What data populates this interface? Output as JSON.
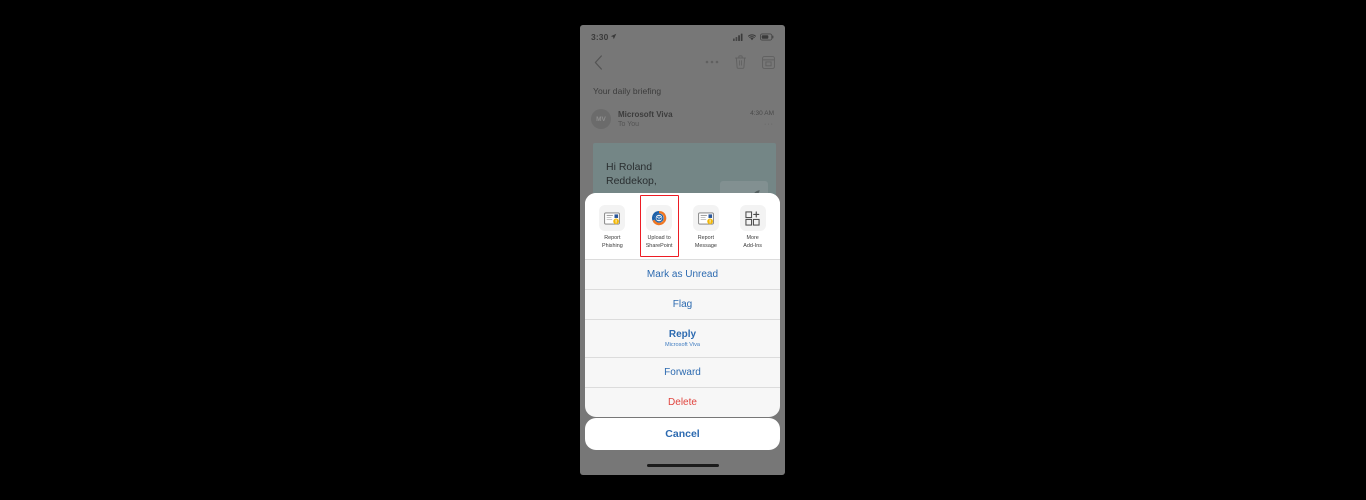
{
  "status_bar": {
    "time": "3:30",
    "location_icon": "location-arrow-icon",
    "signal_icon": "cellular-signal-icon",
    "wifi_icon": "wifi-icon",
    "battery_icon": "battery-icon"
  },
  "nav_bar": {
    "back_icon": "chevron-left-icon",
    "more_icon": "ellipsis-icon",
    "delete_icon": "trash-icon",
    "archive_icon": "archive-icon"
  },
  "email": {
    "subject": "Your daily briefing",
    "avatar_initials": "MV",
    "sender_name": "Microsoft Viva",
    "recipients": "To You",
    "time": "4:30 AM",
    "overflow": "···",
    "greeting": "Hi Roland Reddekop,"
  },
  "addins": {
    "items": [
      {
        "label": "Report\nPhishing",
        "icon": "report-phishing-icon",
        "highlighted": false
      },
      {
        "label": "Upload to\nSharePoint",
        "icon": "sharepoint-icon",
        "highlighted": true
      },
      {
        "label": "Report\nMessage",
        "icon": "report-message-icon",
        "highlighted": false
      },
      {
        "label": "More\nAdd-Ins",
        "icon": "more-addins-grid-icon",
        "highlighted": false
      }
    ]
  },
  "action_sheet": {
    "mark_unread": "Mark as Unread",
    "flag": "Flag",
    "reply": "Reply",
    "reply_sub": "Microsoft Viva",
    "forward": "Forward",
    "delete": "Delete",
    "cancel": "Cancel"
  },
  "colors": {
    "accent_blue": "#2c6ab0",
    "danger_red": "#e0443e",
    "annotation_red": "#ed1c24",
    "card_teal": "#8aa2a3"
  }
}
